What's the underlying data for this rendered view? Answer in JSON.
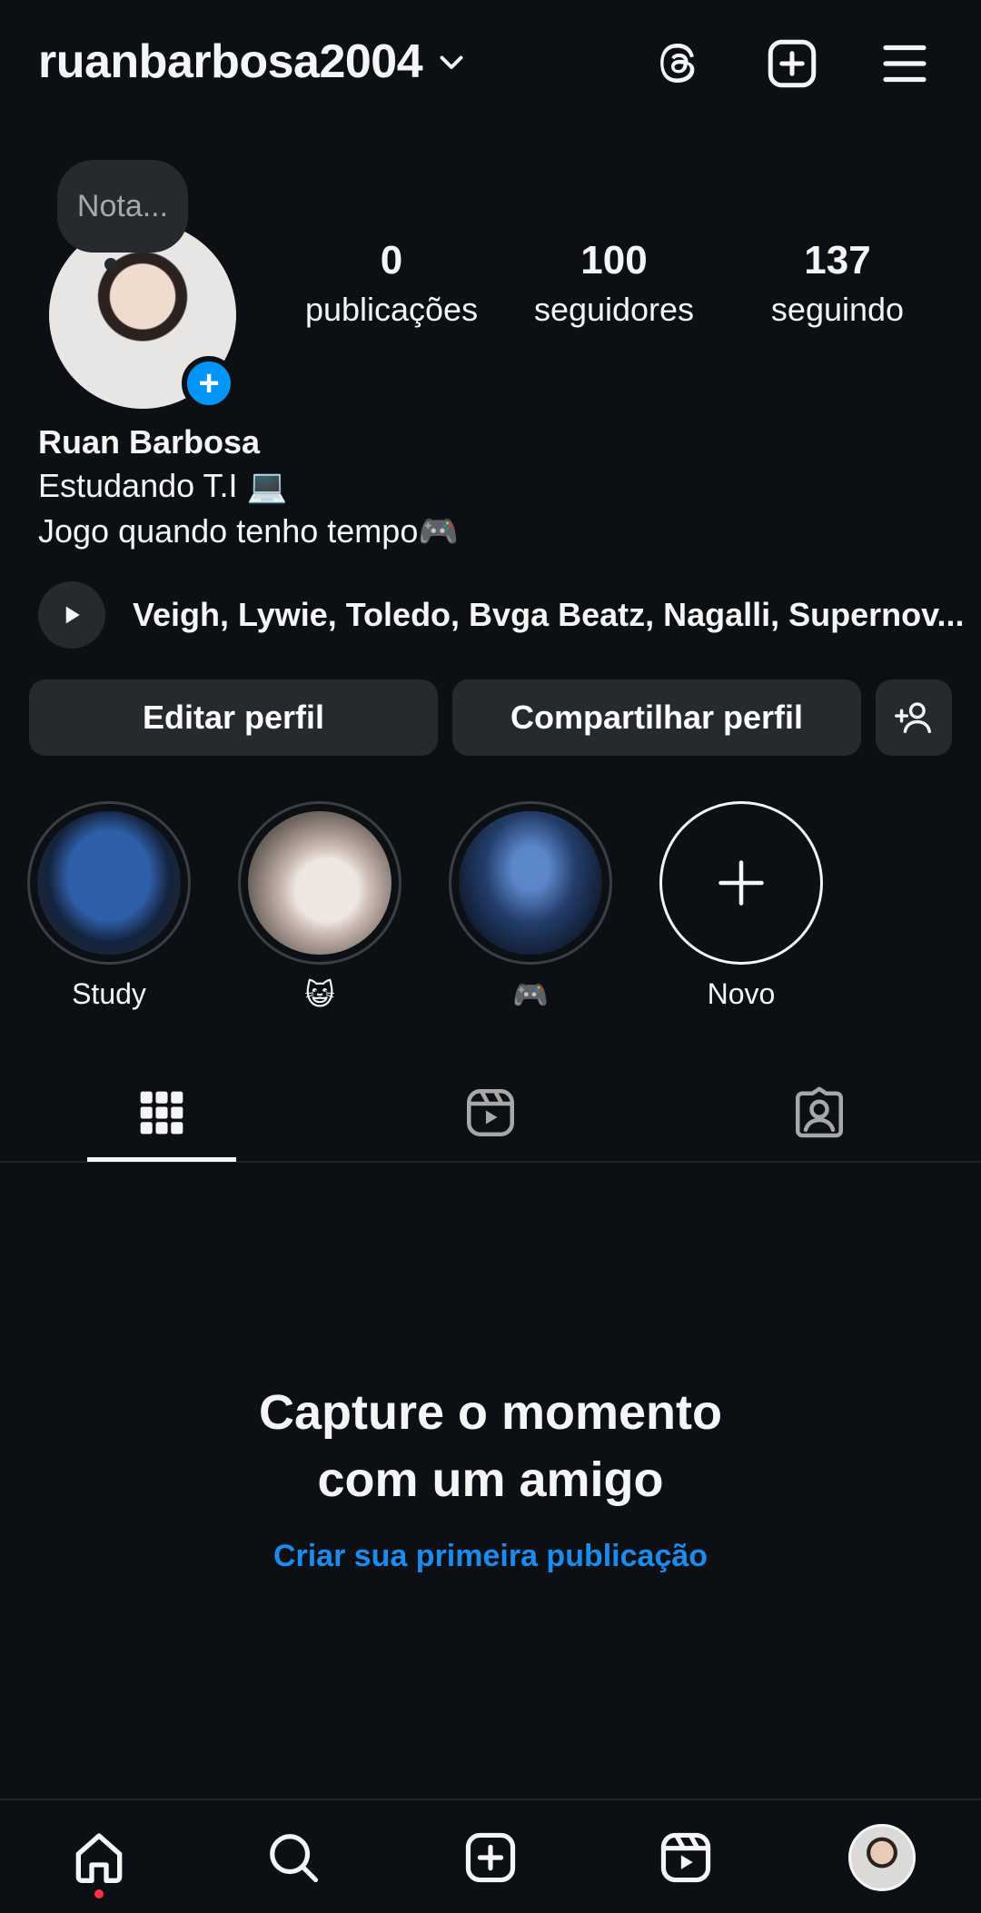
{
  "header": {
    "username": "ruanbarbosa2004"
  },
  "profile": {
    "note_placeholder": "Nota...",
    "stats": [
      {
        "value": "0",
        "label": "publicações"
      },
      {
        "value": "100",
        "label": "seguidores"
      },
      {
        "value": "137",
        "label": "seguindo"
      }
    ],
    "name": "Ruan Barbosa",
    "bio_line1": "Estudando T.I 💻",
    "bio_line2": "Jogo quando tenho tempo🎮",
    "music": "Veigh, Lywie, Toledo, Bvga Beatz, Nagalli, Supernov..."
  },
  "actions": {
    "edit_profile": "Editar perfil",
    "share_profile": "Compartilhar perfil"
  },
  "highlights": [
    {
      "label": "Study"
    },
    {
      "label": "😺"
    },
    {
      "label": "🎮"
    },
    {
      "label": "Novo"
    }
  ],
  "empty_state": {
    "title_line1": "Capture o momento",
    "title_line2": "com um amigo",
    "link": "Criar sua primeira publicação"
  },
  "colors": {
    "background": "#0c1014",
    "accent": "#0095f6",
    "link": "#1a8cf0",
    "button": "#262a2f"
  }
}
